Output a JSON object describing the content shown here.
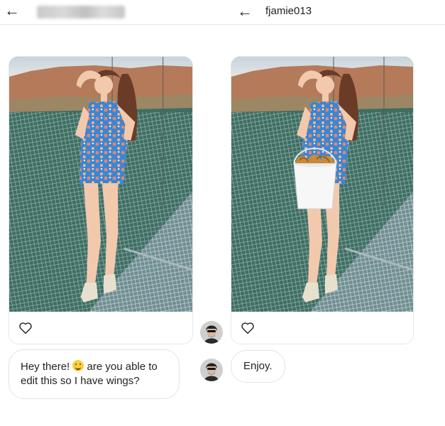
{
  "left_chat": {
    "back_icon": "arrow-left-icon",
    "contact_name_hidden": true,
    "post": {
      "image": "photo-woman-on-rope-bridge",
      "like_icon": "heart-icon"
    },
    "message": {
      "text_before": "Hey there! ",
      "emoji": "smiling-face-emoji",
      "text_after": " are you able to edit this so I have wings?"
    }
  },
  "right_chat": {
    "back_icon": "arrow-left-icon",
    "username": "fjamie013",
    "post": {
      "image": "photo-woman-holding-chicken-wings-bucket",
      "like_icon": "heart-icon"
    },
    "message": {
      "text": "Enjoy."
    }
  },
  "colors": {
    "water": "#3d6e63",
    "dress": "#3a86d6",
    "accent_coral": "#f08462"
  }
}
